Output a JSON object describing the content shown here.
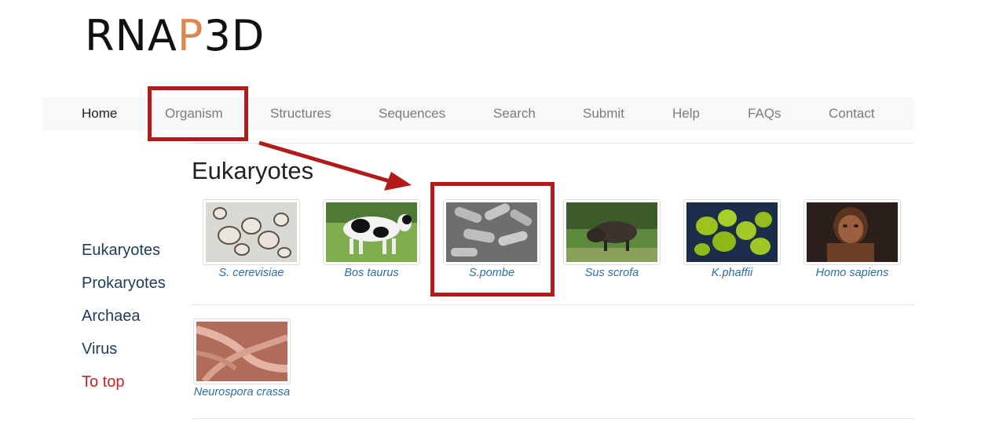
{
  "logo": {
    "part1": "RNA",
    "accent": "P",
    "part2": "3D"
  },
  "nav": {
    "items": [
      "Home",
      "Organism",
      "Structures",
      "Sequences",
      "Search",
      "Submit",
      "Help",
      "FAQs",
      "Contact"
    ],
    "active": "Home"
  },
  "page_title": "Eukaryotes",
  "sidebar": {
    "items": [
      "Eukaryotes",
      "Prokaryotes",
      "Archaea",
      "Virus"
    ],
    "to_top": "To top"
  },
  "organisms": [
    {
      "name": "S. cerevisiae",
      "icon": "yeast-microscopy-image"
    },
    {
      "name": "Bos taurus",
      "icon": "cow-photo"
    },
    {
      "name": "S.pombe",
      "icon": "rod-bacteria-micrograph"
    },
    {
      "name": "Sus scrofa",
      "icon": "wild-boar-photo"
    },
    {
      "name": "K.phaffii",
      "icon": "green-yeast-cells-image"
    },
    {
      "name": "Homo sapiens",
      "icon": "early-human-photo"
    },
    {
      "name": "Neurospora crassa",
      "icon": "fungal-hyphae-image"
    }
  ],
  "colors": {
    "logo_accent": "#d9894f",
    "nav_background": "#f7f8f9",
    "link_blue": "#2d6fa8",
    "sidebar_link": "#1d3a5f",
    "to_top": "#cc2222",
    "annotation_red": "#b31b1b"
  }
}
